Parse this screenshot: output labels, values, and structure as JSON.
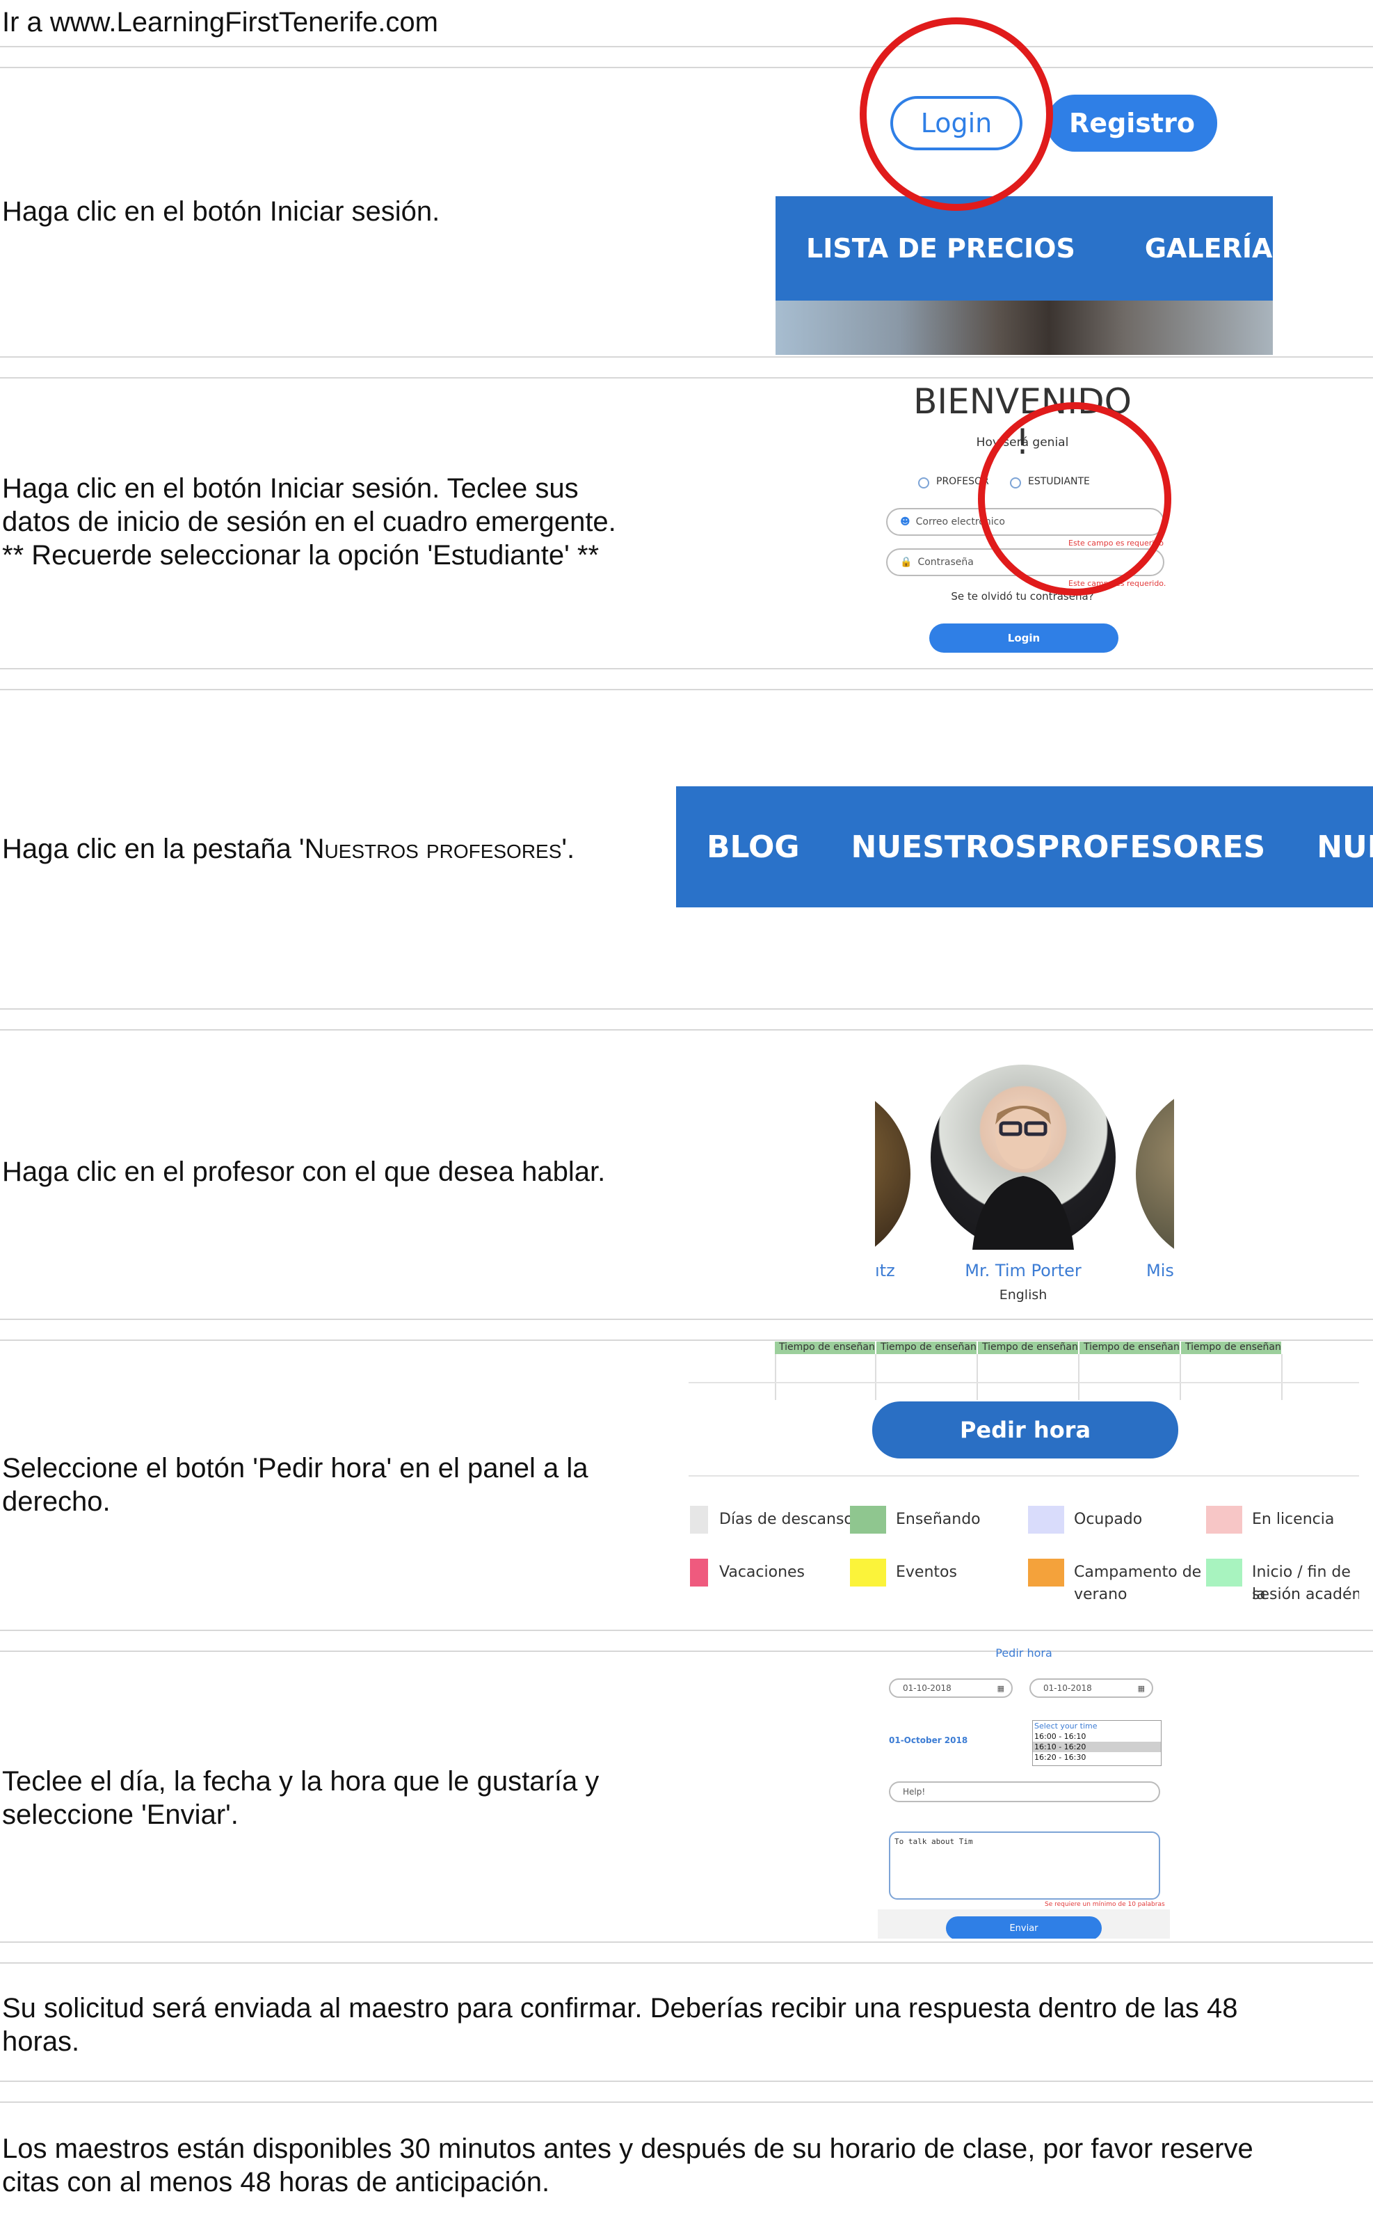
{
  "rows": {
    "r1": "Ir a www.LearningFirstTenerife.com",
    "r2": "Haga clic en el botón Iniciar sesión.",
    "r3_line1": "Haga clic en el botón Iniciar sesión.  Teclee sus",
    "r3_line2": "datos de inicio de sesión en el cuadro emergente.",
    "r3_line3": "** Recuerde seleccionar la opción 'Estudiante' **",
    "r4_prefix": "Haga clic en la pestaña '",
    "r4_tab": "Nuestros profesores",
    "r4_suffix": "'.",
    "r5": "Haga clic en el profesor con el que desea hablar.",
    "r6_line1": "Seleccione el botón 'Pedir hora' en el panel a la",
    "r6_line2": "derecho.",
    "r7_line1": "Teclee el día, la fecha y la hora que le gustaría y",
    "r7_line2": "seleccione 'Enviar'.",
    "r8_line1": "Su solicitud será enviada al maestro para confirmar.   Deberías recibir una respuesta dentro de las 48",
    "r8_line2": "horas.",
    "r9_line1": "Los maestros están disponibles 30 minutos antes y después de su horario de clase, por favor reserve",
    "r9_line2": "citas con al menos 48 horas de anticipación."
  },
  "shot_login": {
    "login_button": "Login",
    "register_button": "Registro",
    "nav": [
      "LISTA DE PRECIOS",
      "GALERÍA"
    ]
  },
  "shot_modal": {
    "title": "BIENVENIDO !",
    "subtitle": "Hoy será genial",
    "radio_profesor": "PROFESOR",
    "radio_estudiante": "ESTUDIANTE",
    "email_placeholder": "Correo electrónico",
    "email_error": "Este campo es requerido",
    "password_placeholder": "Contraseña",
    "password_error": "Este campo es requerido.",
    "forgot": "Se te olvidó tu contraseña?",
    "login_button": "Login"
  },
  "shot_tabs": {
    "tabs": [
      "BLOG",
      "NUESTROSPROFESORES",
      "NUES"
    ]
  },
  "shot_teachers": {
    "left_name": "ıtz",
    "name": "Mr. Tim Porter",
    "language": "English",
    "right_name": "Mis"
  },
  "shot_schedule": {
    "header_cells": [
      "Tiempo de enseñanza",
      "Tiempo de enseñanza",
      "Tiempo de enseñanza",
      "Tiempo de enseñanza",
      "Tiempo de enseñanza"
    ],
    "button": "Pedir hora",
    "legend": [
      {
        "label": "Días de descanso",
        "color": "#e6e6e6"
      },
      {
        "label": "Enseñando",
        "color": "#8fc68f"
      },
      {
        "label": "Ocupado",
        "color": "#d9dcfb"
      },
      {
        "label": "En licencia",
        "color": "#f7c6c6"
      },
      {
        "label": "Vacaciones",
        "color": "#ef5a7e"
      },
      {
        "label": "Eventos",
        "color": "#fbf33a"
      },
      {
        "label": "Campamento de verano",
        "color": "#f4a23b"
      },
      {
        "label": "Inicio / fin de la sesión académica",
        "color": "#a8f3bf"
      }
    ],
    "legend_wrapped": {
      "camp_line1": "Campamento de",
      "camp_line2": "verano",
      "inicio_line1": "Inicio / fin de la",
      "inicio_line2": "sesión académi"
    }
  },
  "shot_form": {
    "title": "Pedir hora",
    "date_from": "01-10-2018",
    "date_to": "01-10-2018",
    "selected_date": "01-October 2018",
    "time_header": "Select your time",
    "times": [
      "16:00 - 16:10",
      "16:10 - 16:20",
      "16:20 - 16:30"
    ],
    "selected_time": "16:10 - 16:20",
    "subject": "Help!",
    "message": "To talk about Tim",
    "min_words": "Se requiere un mínimo de 10 palabras",
    "submit": "Enviar"
  },
  "colors": {
    "red_circle": "#e01b1b",
    "brand_blue": "#2a72c9",
    "button_blue": "#2f7fe6"
  }
}
